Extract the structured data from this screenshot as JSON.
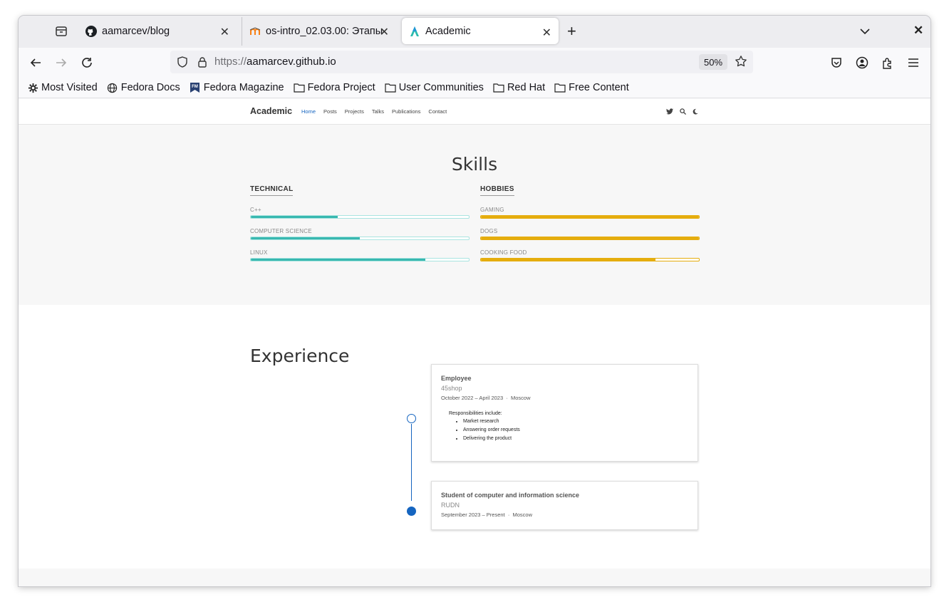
{
  "browser": {
    "tabs": [
      {
        "title": "aamarcev/blog",
        "icon": "github-icon"
      },
      {
        "title": "os-intro_02.03.00: Этапы",
        "icon": "moodle-icon"
      },
      {
        "title": "Academic",
        "icon": "academic-logo-icon",
        "active": true
      }
    ],
    "url_scheme": "https://",
    "url_host": "aamarcev.github.io",
    "zoom": "50%",
    "bookmarks": [
      {
        "label": "Most Visited",
        "icon": "gear-icon"
      },
      {
        "label": "Fedora Docs",
        "icon": "globe-icon"
      },
      {
        "label": "Fedora Magazine",
        "icon": "fedora-magazine-icon"
      },
      {
        "label": "Fedora Project",
        "icon": "folder-icon"
      },
      {
        "label": "User Communities",
        "icon": "folder-icon"
      },
      {
        "label": "Red Hat",
        "icon": "folder-icon"
      },
      {
        "label": "Free Content",
        "icon": "folder-icon"
      }
    ]
  },
  "site": {
    "brand": "Academic",
    "menu": [
      "Home",
      "Posts",
      "Projects",
      "Talks",
      "Publications",
      "Contact"
    ],
    "active_menu": "Home",
    "accent": "#1565c0"
  },
  "skills": {
    "title": "Skills",
    "technical": {
      "heading": "TECHNICAL",
      "color": "#38b8b0",
      "items": [
        {
          "label": "C++",
          "level": 0.4
        },
        {
          "label": "COMPUTER SCIENCE",
          "level": 0.5
        },
        {
          "label": "LINUX",
          "level": 0.8
        }
      ]
    },
    "hobbies": {
      "heading": "HOBBIES",
      "color": "#e5ad0e",
      "items": [
        {
          "label": "GAMING",
          "level": 1.0
        },
        {
          "label": "DOGS",
          "level": 1.0
        },
        {
          "label": "COOKING FOOD",
          "level": 0.8
        }
      ]
    }
  },
  "experience": {
    "title": "Experience",
    "entries": [
      {
        "role": "Employee",
        "org": "45shop",
        "dates": "October 2022 – April 2023",
        "location": "Moscow",
        "resp_intro": "Responsibilities include:",
        "responsibilities": [
          "Market research",
          "Answering order requests",
          "Delivering the product"
        ]
      },
      {
        "role": "Student of computer and information science",
        "org": "RUDN",
        "dates": "September 2023 – Present",
        "location": "Moscow"
      }
    ]
  }
}
